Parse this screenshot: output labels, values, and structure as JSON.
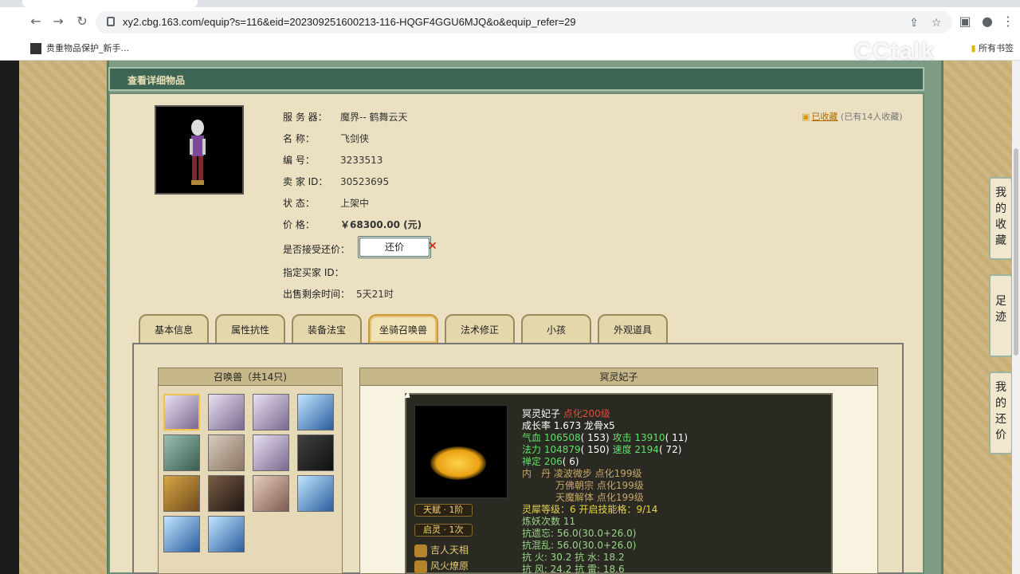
{
  "browser": {
    "url": "xy2.cbg.163.com/equip?s=116&eid=202309251600213-116-HQGF4GGU6MJQ&o&equip_refer=29",
    "bookmark": "贵重物品保护_新手...",
    "bookmark_right": "所有书签"
  },
  "watermark": "CCtalk",
  "page": {
    "header": "查看详细物品",
    "favorite_label": "已收藏",
    "favorite_count": "(已有14人收藏)",
    "rows": [
      {
        "label": "服 务 器：",
        "value": "魔界-- 鹤舞云天"
      },
      {
        "label": "名      称：",
        "value": "飞剑侠"
      },
      {
        "label": "编      号：",
        "value": "3233513"
      },
      {
        "label": "卖 家  ID：",
        "value": "30523695"
      },
      {
        "label": "状      态：",
        "value": "上架中"
      },
      {
        "label": "价      格：",
        "value": "￥68300.00 (元)"
      },
      {
        "label": "是否接受还价：",
        "value": ""
      },
      {
        "label": "指定买家 ID：",
        "value": ""
      },
      {
        "label": "出售剩余时间：",
        "value": "5天21时"
      }
    ],
    "offer_button": "还价",
    "tabs": [
      "基本信息",
      "属性抗性",
      "装备法宝",
      "坐骑召唤兽",
      "法术修正",
      "小孩",
      "外观道具"
    ],
    "active_tab": 3,
    "pets_title": "召唤兽（共14只)",
    "detail_title": "冥灵妃子",
    "pet": {
      "name": "冥灵妃子",
      "level": "点化200级",
      "growth": "成长率 1.673 龙骨x5",
      "hp": "106508",
      "hp_b": "( 153)",
      "atk": "13910",
      "atk_b": "( 11)",
      "mp": "104879",
      "mp_b": "( 150)",
      "spd": "2194",
      "spd_b": "( 72)",
      "zen": "206",
      "zen_b": "( 6)",
      "inner1": "凌波微步 点化199级",
      "inner2": "万佛朝宗 点化199级",
      "inner3": "天魔解体 点化199级",
      "lingxi": "灵犀等级：6 开启技能格：9/14",
      "lianyao": "炼妖次数 11",
      "r1": "抗遗忘: 56.0(30.0+26.0)",
      "r2": "抗混乱: 56.0(30.0+26.0)",
      "r3": "抗    火: 30.2 抗    水: 18.2",
      "r4": "抗    风: 24.2 抗    雷: 18.6"
    },
    "badges": [
      "天赋 · 1阶",
      "启灵 · 1次"
    ],
    "skills": [
      "吉人天相",
      "风火燎原"
    ],
    "side_buttons": [
      "我的收藏",
      "足迹",
      "我的还价"
    ]
  }
}
